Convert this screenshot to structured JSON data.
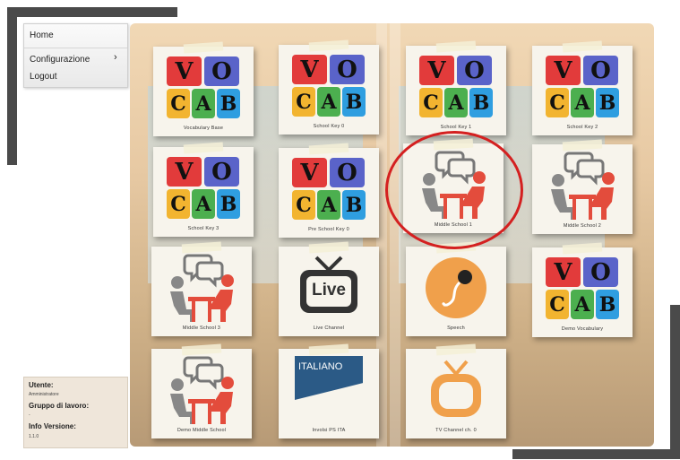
{
  "menu": {
    "items": [
      {
        "label": "Home"
      },
      {
        "label": "Configurazione",
        "arrow": "›"
      },
      {
        "label": "Logout"
      }
    ]
  },
  "info": {
    "user_label": "Utente:",
    "user_value": "Amministratore",
    "group_label": "Gruppo di lavoro:",
    "group_value": "-",
    "version_label": "Info Versione:",
    "version_value": "1.1.0"
  },
  "vocab_letters": [
    "V",
    "O",
    "C",
    "A",
    "B"
  ],
  "vocab_colors": {
    "v": "#e23b3b",
    "o": "#5a63c9",
    "c": "#f2b430",
    "a": "#4caf4f",
    "b": "#2f9ee0"
  },
  "tiles": [
    {
      "icon": "vocab",
      "caption": "Vocabulary Base"
    },
    {
      "icon": "vocab",
      "caption": "School Key 0"
    },
    {
      "icon": "vocab",
      "caption": "School Key 1"
    },
    {
      "icon": "vocab",
      "caption": "School Key 2"
    },
    {
      "icon": "vocab",
      "caption": "School Key 3"
    },
    {
      "icon": "vocab",
      "caption": "Pre School Key 0"
    },
    {
      "icon": "conversation",
      "caption": "Middle School 1"
    },
    {
      "icon": "conversation",
      "caption": "Middle School 2"
    },
    {
      "icon": "conversation",
      "caption": "Middle School 3"
    },
    {
      "icon": "live-tv",
      "caption": "Live Channel",
      "tv_text": "Live"
    },
    {
      "icon": "speech-mic",
      "caption": "Speech"
    },
    {
      "icon": "vocab",
      "caption": "Demo Vocabulary"
    },
    {
      "icon": "conversation",
      "caption": "Demo Middle School"
    },
    {
      "icon": "italiano",
      "caption": "Involsi PS ITA",
      "tile_text": "ITALIANO"
    },
    {
      "icon": "tv-orange",
      "caption": "TV Channel ch. 0"
    }
  ],
  "highlight_color": "#d42020"
}
